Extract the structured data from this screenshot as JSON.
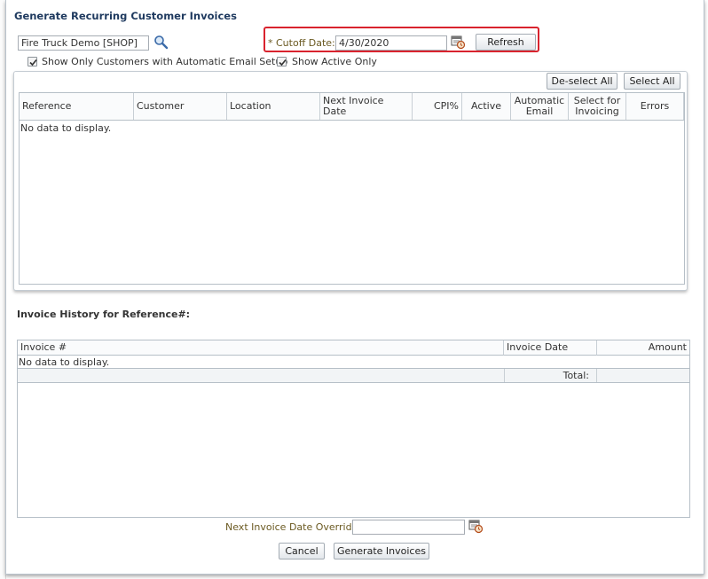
{
  "dialog": {
    "title": "Generate Recurring Customer Invoices"
  },
  "filters": {
    "shop_value": "Fire Truck Demo [SHOP]",
    "cutoff_label": "* Cutoff Date:",
    "cutoff_value": "4/30/2020",
    "refresh_label": "Refresh",
    "email_setup_label": "Show Only Customers with Automatic Email Setup",
    "email_setup_checked": true,
    "active_only_label": "Show Active Only",
    "active_only_checked": true
  },
  "toolbar": {
    "deselect_all": "De-select All",
    "select_all": "Select All"
  },
  "main_grid": {
    "columns": [
      "Reference",
      "Customer",
      "Location",
      "Next Invoice Date",
      "CPI%",
      "Active",
      "Automatic Email",
      "Select for Invoicing",
      "Errors"
    ],
    "empty_text": "No data to display."
  },
  "history": {
    "title": "Invoice History for Reference#:",
    "columns": [
      "Invoice #",
      "Invoice Date",
      "Amount"
    ],
    "empty_text": "No data to display.",
    "total_label": "Total:"
  },
  "footer": {
    "override_label": "Next Invoice Date Override:",
    "override_value": "",
    "cancel_label": "Cancel",
    "generate_label": "Generate Invoices"
  },
  "colors": {
    "highlight": "#d9232e",
    "title": "#1f3a5f",
    "field_label": "#6b5a22"
  }
}
